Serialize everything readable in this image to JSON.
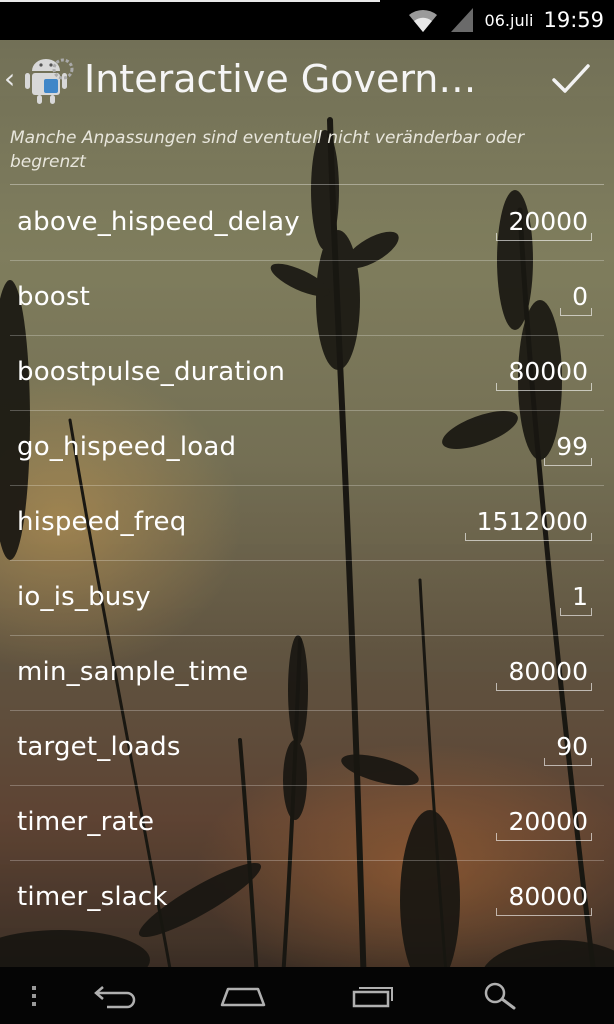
{
  "status_bar": {
    "date": "06.juli",
    "time": "19:59",
    "icons": [
      "wifi-icon",
      "cell-signal-icon"
    ]
  },
  "action_bar": {
    "title": "Interactive Govern…",
    "back_icon": "chevron-left-icon",
    "app_icon": "android-settings-icon",
    "confirm_icon": "checkmark-icon"
  },
  "note": "Manche Anpassungen sind eventuell nicht veränderbar oder begrenzt",
  "settings": [
    {
      "label": "above_hispeed_delay",
      "value": "20000"
    },
    {
      "label": "boost",
      "value": "0"
    },
    {
      "label": "boostpulse_duration",
      "value": "80000"
    },
    {
      "label": "go_hispeed_load",
      "value": "99"
    },
    {
      "label": "hispeed_freq",
      "value": "1512000"
    },
    {
      "label": "io_is_busy",
      "value": "1"
    },
    {
      "label": "min_sample_time",
      "value": "80000"
    },
    {
      "label": "target_loads",
      "value": "90"
    },
    {
      "label": "timer_rate",
      "value": "20000"
    },
    {
      "label": "timer_slack",
      "value": "80000"
    }
  ],
  "nav_bar": {
    "icons": [
      "overflow-menu-icon",
      "back-icon",
      "home-icon",
      "recent-apps-icon",
      "search-icon"
    ]
  },
  "colors": {
    "status_bar_bg": "#000000",
    "nav_bar_bg": "#050505",
    "text": "#ffffff"
  }
}
